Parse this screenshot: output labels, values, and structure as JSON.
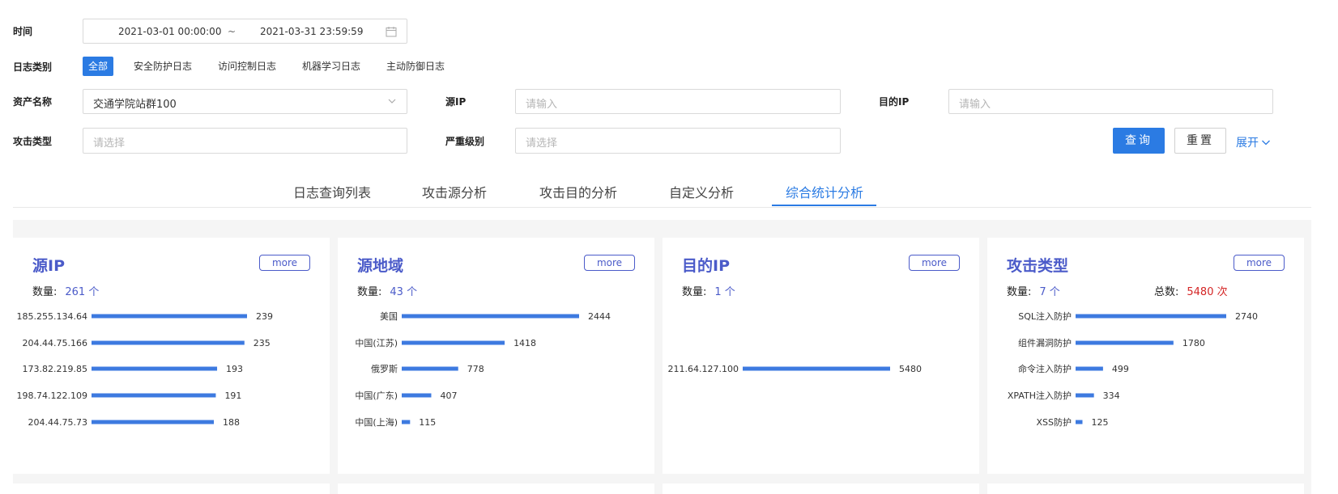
{
  "filters": {
    "time_label": "时间",
    "time_start": "2021-03-01 00:00:00",
    "time_sep": "~",
    "time_end": "2021-03-31 23:59:59",
    "category_label": "日志类别",
    "categories": [
      "全部",
      "安全防护日志",
      "访问控制日志",
      "机器学习日志",
      "主动防御日志"
    ],
    "asset_label": "资产名称",
    "asset_value": "交通学院站群100",
    "src_ip_label": "源IP",
    "src_ip_placeholder": "请输入",
    "dst_ip_label": "目的IP",
    "dst_ip_placeholder": "请输入",
    "attack_type_label": "攻击类型",
    "attack_type_placeholder": "请选择",
    "severity_label": "严重级别",
    "severity_placeholder": "请选择",
    "query_button": "查询",
    "reset_button": "重置",
    "expand_link": "展开"
  },
  "tabs": [
    "日志查询列表",
    "攻击源分析",
    "攻击目的分析",
    "自定义分析",
    "综合统计分析"
  ],
  "active_tab": 4,
  "accent_color": "#2b7be3",
  "title_color": "#4b5bc9",
  "bar_color": "#3d7ae0",
  "cards": [
    {
      "title": "源IP",
      "more": "more",
      "count_label": "数量:",
      "count_value": "261 个",
      "chart_data": {
        "type": "bar",
        "orientation": "horizontal",
        "categories": [
          "185.255.134.64",
          "204.44.75.166",
          "173.82.219.85",
          "198.74.122.109",
          "204.44.75.73"
        ],
        "values": [
          239,
          235,
          193,
          191,
          188
        ],
        "xlim": [
          0,
          239
        ]
      }
    },
    {
      "title": "源地域",
      "more": "more",
      "count_label": "数量:",
      "count_value": "43 个",
      "chart_data": {
        "type": "bar",
        "orientation": "horizontal",
        "categories": [
          "美国",
          "中国(江苏)",
          "俄罗斯",
          "中国(广东)",
          "中国(上海)"
        ],
        "values": [
          2444,
          1418,
          778,
          407,
          115
        ],
        "xlim": [
          0,
          2444
        ]
      }
    },
    {
      "title": "目的IP",
      "more": "more",
      "count_label": "数量:",
      "count_value": "1 个",
      "chart_data": {
        "type": "bar",
        "orientation": "horizontal",
        "categories": [
          "211.64.127.100"
        ],
        "values": [
          5480
        ],
        "xlim": [
          0,
          5480
        ]
      }
    },
    {
      "title": "攻击类型",
      "more": "more",
      "count_label": "数量:",
      "count_value": "7 个",
      "total_label": "总数:",
      "total_value": "5480 次",
      "chart_data": {
        "type": "bar",
        "orientation": "horizontal",
        "categories": [
          "SQL注入防护",
          "组件漏洞防护",
          "命令注入防护",
          "XPATH注入防护",
          "XSS防护"
        ],
        "values": [
          2740,
          1780,
          499,
          334,
          125
        ],
        "xlim": [
          0,
          2740
        ]
      }
    }
  ]
}
